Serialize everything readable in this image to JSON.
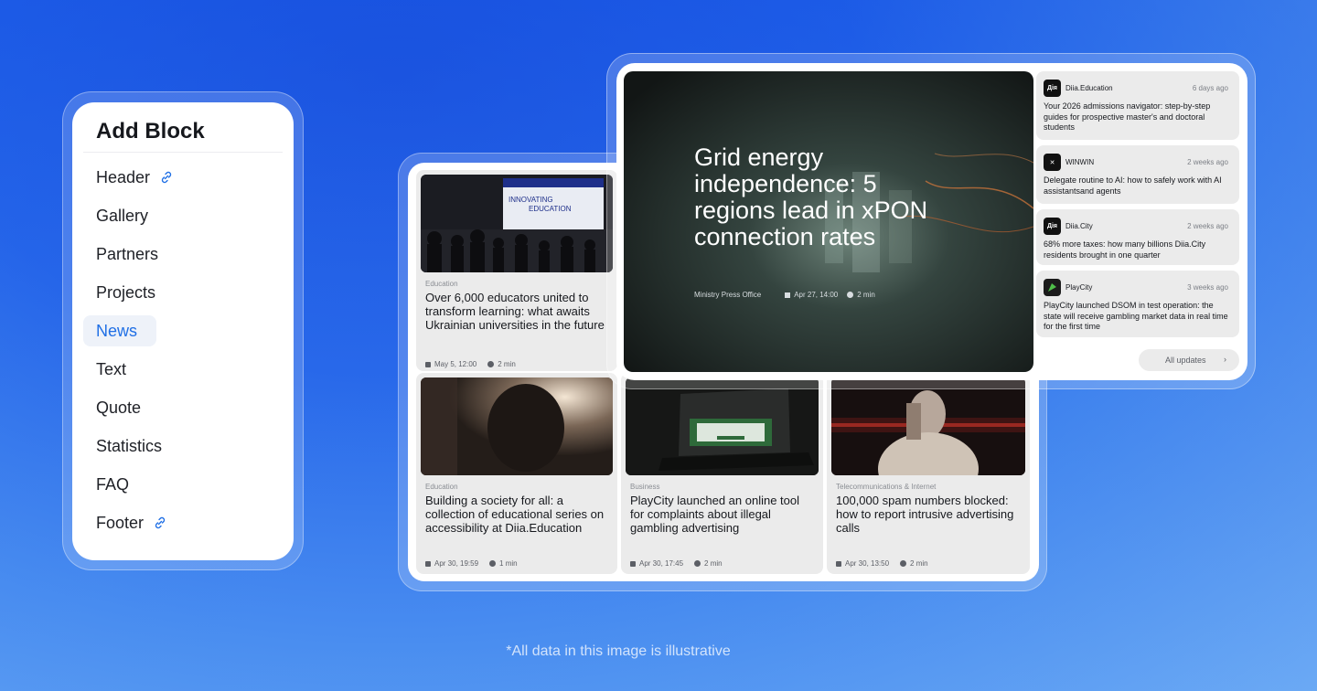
{
  "add_block": {
    "title": "Add Block",
    "items": [
      {
        "label": "Header",
        "linked": true
      },
      {
        "label": "Gallery",
        "linked": false
      },
      {
        "label": "Partners",
        "linked": false
      },
      {
        "label": "Projects",
        "linked": false
      },
      {
        "label": "News",
        "linked": false,
        "active": true
      },
      {
        "label": "Text",
        "linked": false
      },
      {
        "label": "Quote",
        "linked": false
      },
      {
        "label": "Statistics",
        "linked": false
      },
      {
        "label": "FAQ",
        "linked": false
      },
      {
        "label": "Footer",
        "linked": true
      }
    ]
  },
  "hero": {
    "title": "Grid energy independence: 5 regions lead in xPON connection rates",
    "source": "Ministry Press Office",
    "date": "Apr 27, 14:00",
    "read_time": "2 min"
  },
  "updates": {
    "items": [
      {
        "source": "Diia.Education",
        "logo_text": "Дія",
        "time": "6 days ago",
        "text": "Your 2026 admissions navigator: step-by-step guides for prospective master's and doctoral students"
      },
      {
        "source": "WINWIN",
        "logo_text": "✕",
        "time": "2 weeks ago",
        "text": "Delegate routine to AI: how to safely work with AI assistantsand agents"
      },
      {
        "source": "Diia.City",
        "logo_text": "Дія",
        "time": "2 weeks ago",
        "text": "68% more taxes: how many billions Diia.City residents brought in one quarter"
      },
      {
        "source": "PlayCity",
        "logo_text": "",
        "time": "3 weeks ago",
        "text": "PlayCity launched DSOM in test operation: the state will receive gambling market data in real time for the first time"
      }
    ],
    "all_label": "All updates",
    "all_chevron": "›"
  },
  "news": [
    {
      "category": "Education",
      "title": "Over 6,000 educators united to transform learning: what awaits Ukrainian universities in the future",
      "date": "May 5, 12:00",
      "read_time": "2 min",
      "banner_line1": "INNOVATING",
      "banner_line2": "EDUCATION"
    },
    {
      "category": "Education",
      "title": "Building a society for all: a collection of educational series on accessibility at Diia.Education",
      "date": "Apr 30, 19:59",
      "read_time": "1 min"
    },
    {
      "category": "Business",
      "title": "PlayCity launched an online tool for complaints about illegal gambling advertising",
      "date": "Apr 30, 17:45",
      "read_time": "2 min"
    },
    {
      "category": "Telecommunications & Internet",
      "title": "100,000 spam numbers blocked: how to report intrusive advertising calls",
      "date": "Apr 30, 13:50",
      "read_time": "2 min"
    }
  ],
  "footnote": "*All data in this image is illustrative",
  "colors": {
    "accent": "#1f6fe5",
    "card_bg": "#ebebeb"
  }
}
